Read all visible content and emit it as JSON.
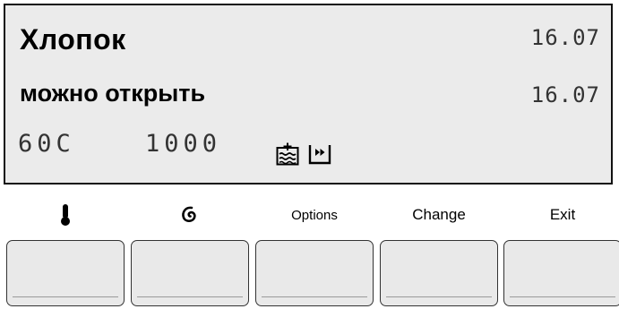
{
  "display": {
    "program": "Хлопок",
    "status": "можно открыть",
    "time_top": "16.07",
    "time_status": "16.07",
    "temperature": "60C",
    "spin_speed": "1000",
    "icons": [
      "extra-rinse-icon",
      "skip-forward-icon"
    ]
  },
  "buttons": [
    {
      "id": "temperature",
      "label": "",
      "icon": "thermometer-icon"
    },
    {
      "id": "spin",
      "label": "",
      "icon": "spin-icon"
    },
    {
      "id": "options",
      "label": "Options"
    },
    {
      "id": "change",
      "label": "Change"
    },
    {
      "id": "exit",
      "label": "Exit"
    }
  ],
  "colors": {
    "display_bg": "#ebebeb",
    "button_bg": "#e9e9e9",
    "text": "#000000",
    "lcd_text": "#333333"
  }
}
